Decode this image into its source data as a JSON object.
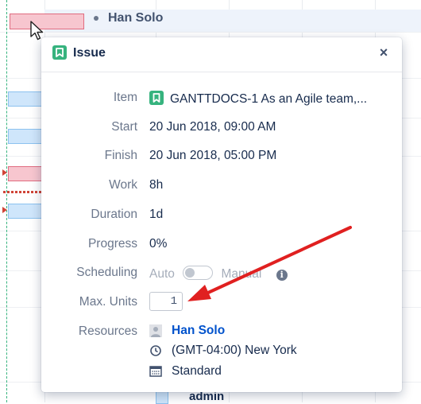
{
  "gantt": {
    "header_resource": "Han Solo",
    "footer_resource": "admin"
  },
  "popup": {
    "title": "Issue",
    "close_label": "×",
    "fields": {
      "item": {
        "label": "Item",
        "value": "GANTTDOCS-1 As an Agile team,..."
      },
      "start": {
        "label": "Start",
        "value": "20 Jun 2018, 09:00 AM"
      },
      "finish": {
        "label": "Finish",
        "value": "20 Jun 2018, 05:00 PM"
      },
      "work": {
        "label": "Work",
        "value": "8h"
      },
      "duration": {
        "label": "Duration",
        "value": "1d"
      },
      "progress": {
        "label": "Progress",
        "value": "0%"
      },
      "scheduling": {
        "label": "Scheduling",
        "auto": "Auto",
        "manual": "Manual",
        "info": "i"
      },
      "max_units": {
        "label": "Max. Units",
        "value": "1"
      },
      "resources": {
        "label": "Resources",
        "name": "Han Solo",
        "timezone": "(GMT-04:00) New York",
        "calendar": "Standard"
      }
    }
  },
  "colors": {
    "accent_green": "#36b37e",
    "link_blue": "#0052cc",
    "annotation_red": "#e02020"
  },
  "icons": {
    "popup_icon": "bookmark-icon",
    "close": "close-icon",
    "item_type": "bookmark-icon",
    "info": "info-icon",
    "avatar": "user-avatar-icon",
    "timezone": "clock-icon",
    "calendar": "calendar-icon",
    "cursor": "mouse-pointer-icon"
  }
}
